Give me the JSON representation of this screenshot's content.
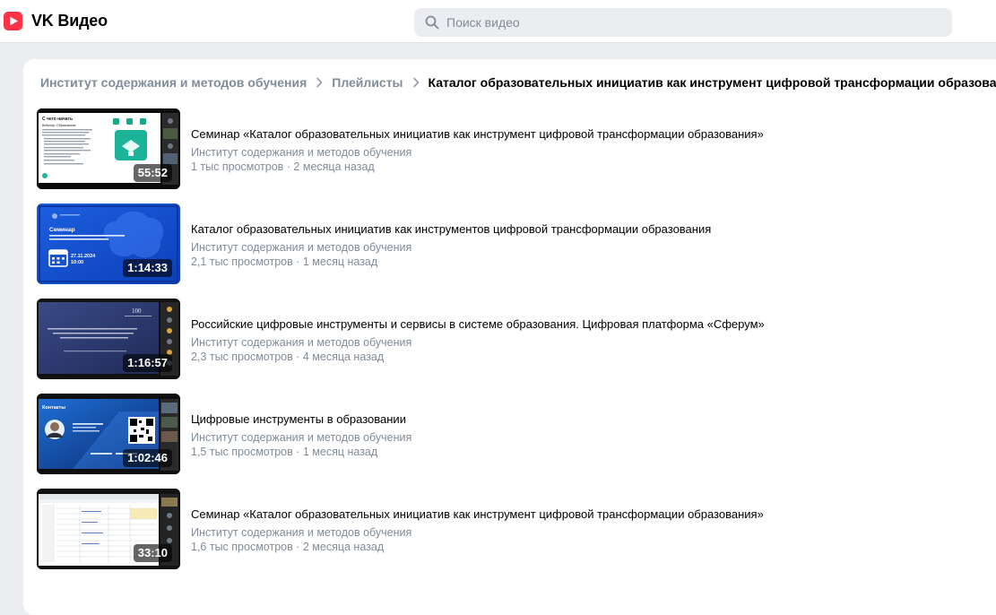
{
  "header": {
    "brand": "VK Видео",
    "search_placeholder": "Поиск видео"
  },
  "colors": {
    "brand_red": "#ff3347",
    "accent_blue": "#0f55d8",
    "muted_text": "#818c99",
    "background": "#ebedf0"
  },
  "breadcrumb": {
    "items": [
      "Институт содержания и методов обучения",
      "Плейлисты"
    ],
    "current": "Каталог образовательных инициатив как инструмент цифровой трансформации образования"
  },
  "videos": [
    {
      "title": "Семинар «Каталог образовательных инициатив как инструмент цифровой трансформации образования»",
      "channel": "Институт содержания и методов обучения",
      "stats": "1 тыс просмотров · 2 месяца назад",
      "duration": "55:52",
      "thumb_heading": "С чего начать",
      "thumb_subheading": "Вебинар: Образование"
    },
    {
      "title": "Каталог образовательных инициатив как инструментов цифровой трансформации образования",
      "channel": "Институт содержания и методов обучения",
      "stats": "2,1 тыс просмотров · 1 месяц назад",
      "duration": "1:14:33",
      "thumb_heading": "Семинар",
      "thumb_subheading": "«Каталог образовательных инициатив как инструмент цифровой трансформации образования»",
      "thumb_date": "27.11.2024",
      "thumb_time": "10:00"
    },
    {
      "title": "Российские цифровые инструменты и сервисы в системе образования. Цифровая платформа «Сферум»",
      "channel": "Институт содержания и методов обучения",
      "stats": "2,3 тыс просмотров · 4 месяца назад",
      "duration": "1:16:57",
      "thumb_heading": "Российские цифровые инструменты и сервисы в системе образования. Цифровая платформа «Сферум»",
      "thumb_badge": "100"
    },
    {
      "title": "Цифровые инструменты в образовании",
      "channel": "Институт содержания и методов обучения",
      "stats": "1,5 тыс просмотров · 1 месяц назад",
      "duration": "1:02:46",
      "thumb_heading": "Контакты"
    },
    {
      "title": "Семинар «Каталог образовательных инициатив как инструмент цифровой трансформации образования»",
      "channel": "Институт содержания и методов обучения",
      "stats": "1,6 тыс просмотров · 2 месяца назад",
      "duration": "33:10"
    }
  ]
}
